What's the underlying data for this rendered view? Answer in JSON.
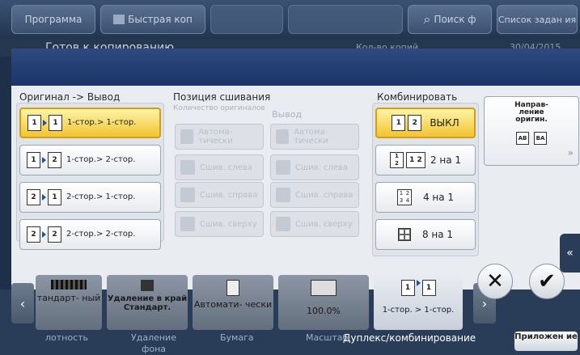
{
  "topbar": {
    "program_label": "Программа",
    "quick_copy_label": "Быстрая коп",
    "search_label": "Поиск ф",
    "task_list_label": "Список задан ия"
  },
  "status": {
    "title": "Готов к копированию",
    "copies_label": "Кол-во копий",
    "date": "30/04/2015"
  },
  "dialog": {
    "orig_output": {
      "label": "Оригинал -> Вывод",
      "options": [
        {
          "text": "1-стор.> 1-стор.",
          "selected": true
        },
        {
          "text": "1-стор.> 2-стор.",
          "selected": false
        },
        {
          "text": "2-стор.> 1-стор.",
          "selected": false
        },
        {
          "text": "2-стор.> 2-стор.",
          "selected": false
        }
      ]
    },
    "binding": {
      "label": "Позиция сшивания",
      "original_col": "Количество оригиналов",
      "output_col": "Вывод",
      "original_opts": [
        "Автома- тически",
        "Сшив. слева",
        "Сшив. справа",
        "Сшив. сверху"
      ],
      "output_opts": [
        "Автома- тически",
        "Сшив. слева",
        "Сшив. справа",
        "Сшив. сверху"
      ]
    },
    "combine": {
      "label": "Комбинировать",
      "options": [
        {
          "text": "ВЫКЛ",
          "selected": true
        },
        {
          "text": "2 на 1",
          "selected": false
        },
        {
          "text": "4 на 1",
          "selected": false
        },
        {
          "text": "8 на 1",
          "selected": false
        }
      ]
    },
    "direction": {
      "label": "Направ- ление оригин."
    }
  },
  "bottom": {
    "tiles": [
      {
        "text": "тандарт- ный"
      },
      {
        "text": "Удаление в край Стандарт."
      },
      {
        "text": "Автомати- чески"
      },
      {
        "text": "100.0%"
      },
      {
        "text": "1-стор. > 1-стор."
      }
    ],
    "categories": [
      "лотность",
      "Удаление фона",
      "Бумага",
      "Масштаб",
      "Дуплекс/комбинирование"
    ],
    "apps_label": "Приложен ие"
  },
  "colors": {
    "selected": "#f1c431",
    "header": "#1a3466"
  }
}
